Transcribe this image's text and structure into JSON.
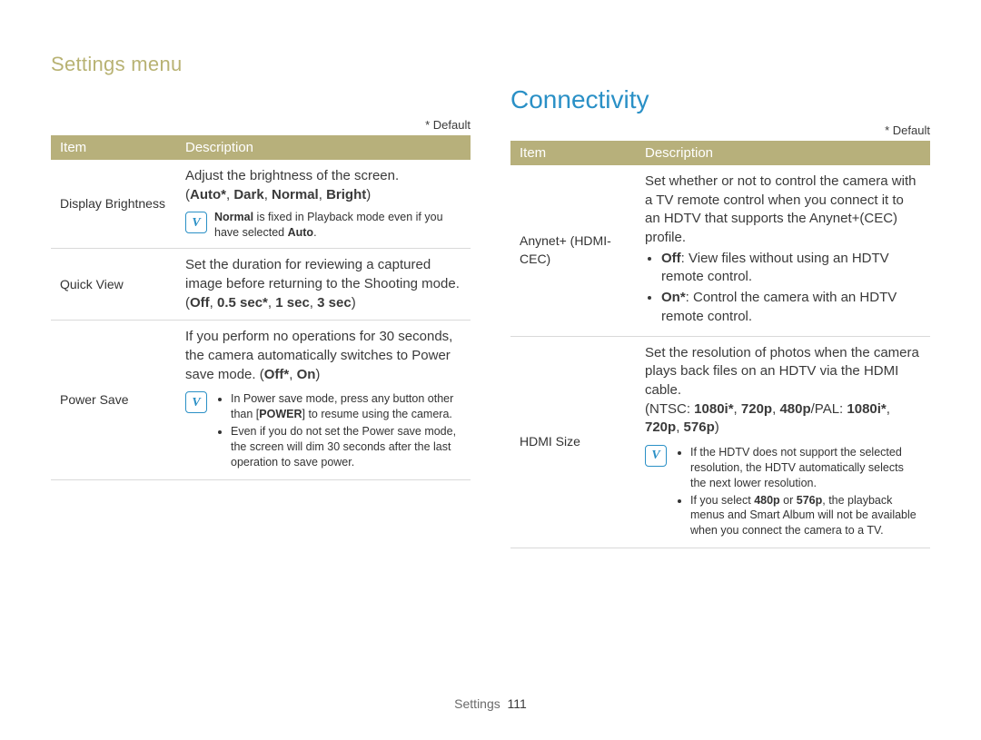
{
  "breadcrumb": "Settings menu",
  "section_title": "Connectivity",
  "default_label": "* Default",
  "header_item": "Item",
  "header_desc": "Description",
  "footer_label": "Settings",
  "footer_page": "111",
  "note_glyph": "V",
  "left_rows": [
    {
      "item": "Display Brightness",
      "lead": "Adjust the brightness of the screen.",
      "options_prefix": "(",
      "options_bold": "Auto*",
      "options_sep1": ", ",
      "options_b2": "Dark",
      "options_sep2": ", ",
      "options_b3": "Normal",
      "options_sep3": ", ",
      "options_b4": "Bright",
      "options_suffix": ")",
      "note_pre": "",
      "note_b1": "Normal",
      "note_mid": " is fixed in Playback mode even if you have selected ",
      "note_b2": "Auto",
      "note_post": "."
    },
    {
      "item": "Quick View",
      "lead": "Set the duration for reviewing a captured image before returning to the Shooting mode.",
      "options_prefix": "(",
      "options_bold": "Off",
      "options_sep1": ", ",
      "options_b2": "0.5 sec*",
      "options_sep2": ", ",
      "options_b3": "1 sec",
      "options_sep3": ", ",
      "options_b4": "3 sec",
      "options_suffix": ")"
    },
    {
      "item": "Power Save",
      "lead_pre": "If you perform no operations for 30 seconds, the camera automatically switches to Power save mode. (",
      "lead_b1": "Off*",
      "lead_mid": ", ",
      "lead_b2": "On",
      "lead_post": ")",
      "note_li1_pre": "In Power save mode, press any button other than [",
      "note_li1_b": "POWER",
      "note_li1_post": "] to resume using the camera.",
      "note_li2": "Even if you do not set the Power save mode, the screen will dim 30 seconds after the last operation to save power."
    }
  ],
  "right_rows": [
    {
      "item": "Anynet+ (HDMI-CEC)",
      "lead": "Set whether or not to control the camera with a TV remote control when you connect it to an HDTV that supports the Anynet+(CEC) profile.",
      "bullets": [
        {
          "label": "Off",
          "text": ": View files without using an HDTV remote control."
        },
        {
          "label": "On*",
          "text": ": Control the camera with an HDTV remote control."
        }
      ]
    },
    {
      "item": "HDMI Size",
      "lead": "Set the resolution of photos when the camera plays back files on an HDTV via the HDMI cable.",
      "opt_pre": "(NTSC: ",
      "opt_b1": "1080i*",
      "opt_s1": ", ",
      "opt_b2": "720p",
      "opt_s2": ", ",
      "opt_b3": "480p",
      "opt_mid": "/PAL: ",
      "opt_b4": "1080i*",
      "opt_s3": ", ",
      "opt_b5": "720p",
      "opt_s4": ", ",
      "opt_b6": "576p",
      "opt_post": ")",
      "note_li1": "If the HDTV does not support the selected resolution, the HDTV automatically selects the next lower resolution.",
      "note_li2_pre": "If you select ",
      "note_li2_b1": "480p",
      "note_li2_mid": " or ",
      "note_li2_b2": "576p",
      "note_li2_post": ", the playback menus and Smart Album will not be available when you connect the camera to a TV."
    }
  ]
}
